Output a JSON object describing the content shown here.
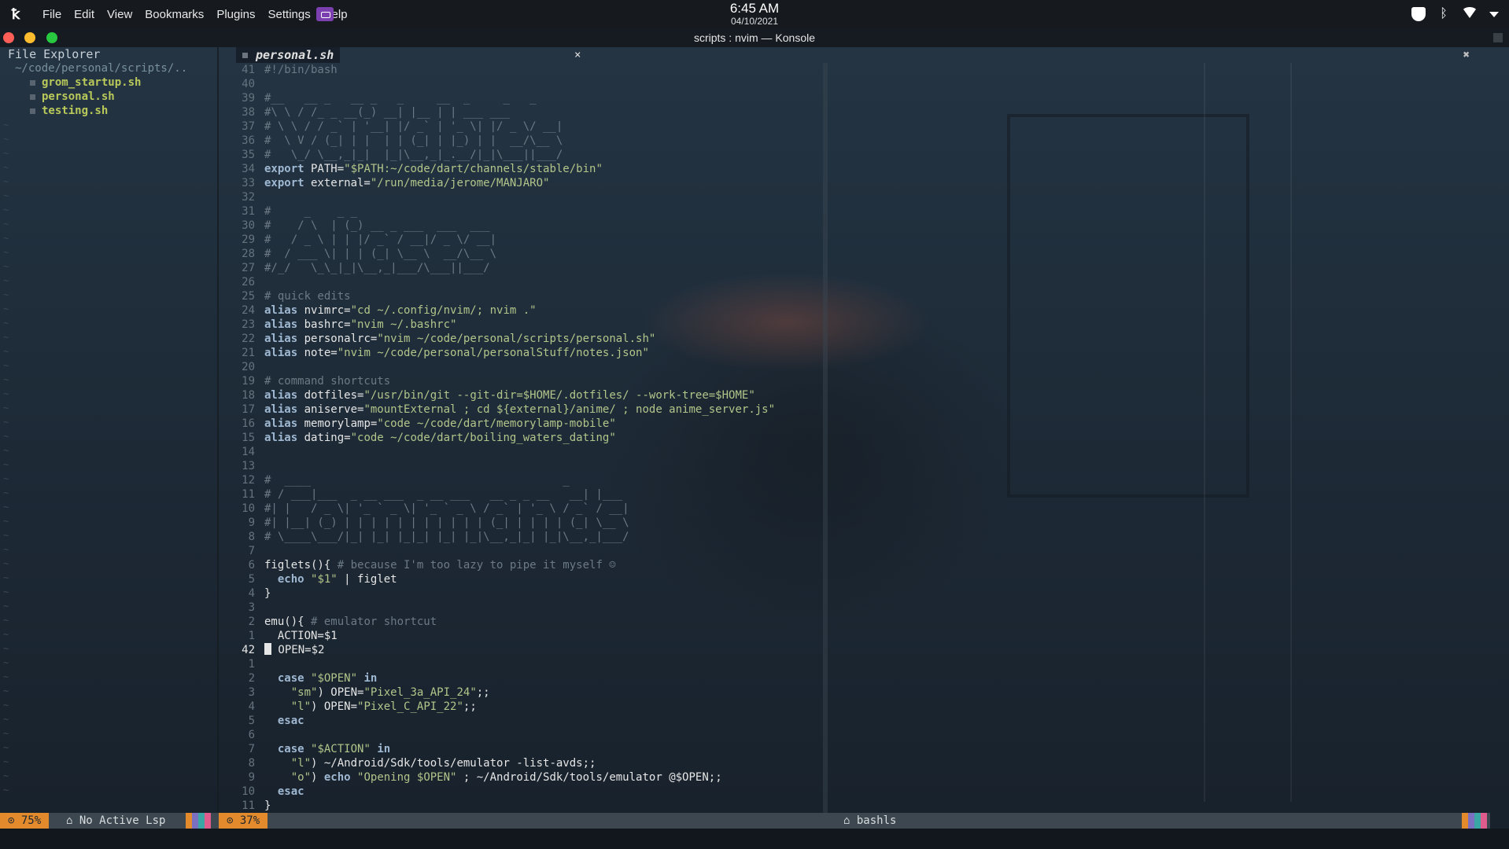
{
  "panel": {
    "menu": [
      "File",
      "Edit",
      "View",
      "Bookmarks",
      "Plugins",
      "Settings",
      "Help"
    ],
    "time": "6:45 AM",
    "date": "04/10/2021"
  },
  "window": {
    "title": "scripts : nvim — Konsole"
  },
  "sidebar": {
    "title": "File Explorer",
    "path": "~/code/personal/scripts/..",
    "files": [
      "grom_startup.sh",
      "personal.sh",
      "testing.sh"
    ]
  },
  "editor": {
    "tab_name": "personal.sh",
    "tab_close": "×",
    "close_all": "✖",
    "lines": [
      {
        "n": "41",
        "t": "#!/bin/bash"
      },
      {
        "n": "40",
        "t": ""
      },
      {
        "n": "39",
        "t": "#__   __ _   __ _   _     __  _     _   _"
      },
      {
        "n": "38",
        "t": "#\\ \\ / /_ _ __(_) __| |__ | | ___ ___"
      },
      {
        "n": "37",
        "t": "# \\ \\ / / _` | '__| |/ _` | '_ \\| |/ _ \\/ __|"
      },
      {
        "n": "36",
        "t": "#  \\ V / (_| | |  | | (_| | |_) | |  __/\\__ \\"
      },
      {
        "n": "35",
        "t": "#   \\_/ \\__,_|_|  |_|\\__,_|_.__/|_|\\___||___/"
      },
      {
        "n": "34",
        "t": "export PATH=\"$PATH:~/code/dart/channels/stable/bin\""
      },
      {
        "n": "33",
        "t": "export external=\"/run/media/jerome/MANJARO\""
      },
      {
        "n": "32",
        "t": ""
      },
      {
        "n": "31",
        "t": "#     _    _ _"
      },
      {
        "n": "30",
        "t": "#    / \\  | (_) __ _ ___  ___  ___"
      },
      {
        "n": "29",
        "t": "#   / _ \\ | | |/ _` / __|/ _ \\/ __|"
      },
      {
        "n": "28",
        "t": "#  / ___ \\| | | (_| \\__ \\  __/\\__ \\"
      },
      {
        "n": "27",
        "t": "#/_/   \\_\\_|_|\\__,_|___/\\___||___/"
      },
      {
        "n": "26",
        "t": ""
      },
      {
        "n": "25",
        "t": "# quick edits"
      },
      {
        "n": "24",
        "t": "alias nvimrc=\"cd ~/.config/nvim/; nvim .\""
      },
      {
        "n": "23",
        "t": "alias bashrc=\"nvim ~/.bashrc\""
      },
      {
        "n": "22",
        "t": "alias personalrc=\"nvim ~/code/personal/scripts/personal.sh\""
      },
      {
        "n": "21",
        "t": "alias note=\"nvim ~/code/personal/personalStuff/notes.json\""
      },
      {
        "n": "20",
        "t": ""
      },
      {
        "n": "19",
        "t": "# command shortcuts"
      },
      {
        "n": "18",
        "t": "alias dotfiles=\"/usr/bin/git --git-dir=$HOME/.dotfiles/ --work-tree=$HOME\""
      },
      {
        "n": "17",
        "t": "alias aniserve=\"mountExternal ; cd ${external}/anime/ ; node anime_server.js\""
      },
      {
        "n": "16",
        "t": "alias memorylamp=\"code ~/code/dart/memorylamp-mobile\""
      },
      {
        "n": "15",
        "t": "alias dating=\"code ~/code/dart/boiling_waters_dating\""
      },
      {
        "n": "14",
        "t": ""
      },
      {
        "n": "13",
        "t": ""
      },
      {
        "n": "12",
        "t": "#  ____                                      _"
      },
      {
        "n": "11",
        "t": "# / ___|___  _ __ ___  _ __ ___   __ _ _ __   __| |___"
      },
      {
        "n": "10",
        "t": "#| |   / _ \\| '_ ` _ \\| '_ ` _ \\ / _` | '_ \\ / _` / __|"
      },
      {
        "n": "9",
        "t": "#| |__| (_) | | | | | | | | | | | (_| | | | | (_| \\__ \\"
      },
      {
        "n": "8",
        "t": "# \\____\\___/|_| |_| |_|_| |_| |_|\\__,_|_| |_|\\__,_|___/"
      },
      {
        "n": "7",
        "t": ""
      },
      {
        "n": "6",
        "t": "figlets(){ # because I'm too lazy to pipe it myself ☺"
      },
      {
        "n": "5",
        "t": "  echo \"$1\" | figlet"
      },
      {
        "n": "4",
        "t": "}"
      },
      {
        "n": "3",
        "t": ""
      },
      {
        "n": "2",
        "t": "emu(){ # emulator shortcut"
      },
      {
        "n": "1",
        "t": "  ACTION=$1"
      },
      {
        "n": "42",
        "t": "  OPEN=$2",
        "current": true
      },
      {
        "n": "1",
        "t": ""
      },
      {
        "n": "2",
        "t": "  case \"$OPEN\" in"
      },
      {
        "n": "3",
        "t": "    \"sm\") OPEN=\"Pixel_3a_API_24\";;"
      },
      {
        "n": "4",
        "t": "    \"l\") OPEN=\"Pixel_C_API_22\";;"
      },
      {
        "n": "5",
        "t": "  esac"
      },
      {
        "n": "6",
        "t": ""
      },
      {
        "n": "7",
        "t": "  case \"$ACTION\" in"
      },
      {
        "n": "8",
        "t": "    \"l\") ~/Android/Sdk/tools/emulator -list-avds;;"
      },
      {
        "n": "9",
        "t": "    \"o\") echo \"Opening $OPEN\" ; ~/Android/Sdk/tools/emulator @$OPEN;;"
      },
      {
        "n": "10",
        "t": "  esac"
      },
      {
        "n": "11",
        "t": "}"
      }
    ]
  },
  "status": {
    "left_pct": "75%",
    "left_lsp": "No Active Lsp",
    "mid_pct": "37%",
    "lang_server": "bashls"
  },
  "colors": {
    "accent": "#e38b2c",
    "keyword": "#9fb8d2",
    "string": "#b2c58a",
    "comment": "#6c7a86"
  }
}
